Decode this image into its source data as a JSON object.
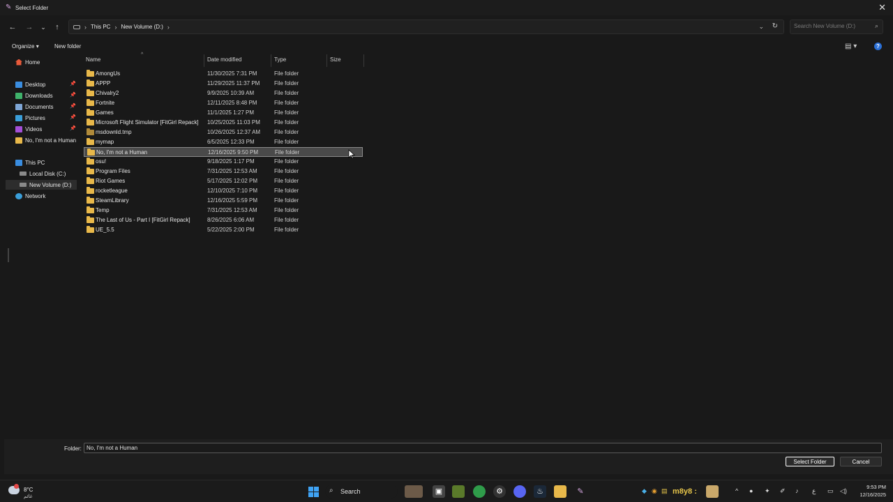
{
  "window": {
    "title": "Select Folder",
    "close_glyph": "✕",
    "icon": "app-icon"
  },
  "nav": {
    "back": "back-icon",
    "forward": "forward-icon",
    "recent": "chevron-down-icon",
    "up": "up-icon",
    "breadcrumbs": [
      "This PC",
      "New Volume (D:)"
    ],
    "search_placeholder": "Search New Volume (D:)"
  },
  "commands": {
    "organize": "Organize",
    "new_folder": "New folder"
  },
  "sidebar": {
    "home": "Home",
    "quick_access": [
      {
        "label": "Desktop",
        "color": "#3a8de0"
      },
      {
        "label": "Downloads",
        "color": "#3fb26b"
      },
      {
        "label": "Documents",
        "color": "#7ea6d6"
      },
      {
        "label": "Pictures",
        "color": "#3a9ed9"
      },
      {
        "label": "Videos",
        "color": "#a44fd8"
      },
      {
        "label": "No, I'm not a Human",
        "color": "#e8b84a"
      }
    ],
    "this_pc": "This PC",
    "drives": [
      "Local Disk (C:)",
      "New Volume (D:)"
    ],
    "network": "Network"
  },
  "columns": {
    "name": "Name",
    "date": "Date modified",
    "type": "Type",
    "size": "Size"
  },
  "files": [
    {
      "name": "AmongUs",
      "date": "11/30/2025 7:31 PM",
      "type": "File folder"
    },
    {
      "name": "APPP",
      "date": "11/29/2025 11:37 PM",
      "type": "File folder"
    },
    {
      "name": "Chivalry2",
      "date": "9/9/2025 10:39 AM",
      "type": "File folder"
    },
    {
      "name": "Fortnite",
      "date": "12/11/2025 8:48 PM",
      "type": "File folder"
    },
    {
      "name": "Games",
      "date": "11/1/2025 1:27 PM",
      "type": "File folder"
    },
    {
      "name": "Microsoft Flight Simulator [FitGirl Repack]",
      "date": "10/25/2025 11:03 PM",
      "type": "File folder"
    },
    {
      "name": "msdownld.tmp",
      "date": "10/26/2025 12:37 AM",
      "type": "File folder"
    },
    {
      "name": "mymap",
      "date": "6/5/2025 12:33 PM",
      "type": "File folder"
    },
    {
      "name": "No, I'm not a Human",
      "date": "12/16/2025 9:50 PM",
      "type": "File folder"
    },
    {
      "name": "osu!",
      "date": "9/18/2025 1:17 PM",
      "type": "File folder"
    },
    {
      "name": "Program Files",
      "date": "7/31/2025 12:53 AM",
      "type": "File folder"
    },
    {
      "name": "Riot Games",
      "date": "5/17/2025 12:02 PM",
      "type": "File folder"
    },
    {
      "name": "rocketleague",
      "date": "12/10/2025 7:10 PM",
      "type": "File folder"
    },
    {
      "name": "SteamLibrary",
      "date": "12/16/2025 5:59 PM",
      "type": "File folder"
    },
    {
      "name": "Temp",
      "date": "7/31/2025 12:53 AM",
      "type": "File folder"
    },
    {
      "name": "The Last of Us - Part I [FitGirl Repack]",
      "date": "8/26/2025 6:06 AM",
      "type": "File folder"
    },
    {
      "name": "UE_5.5",
      "date": "5/22/2025 2:00 PM",
      "type": "File folder"
    }
  ],
  "selected_row": 8,
  "bottom": {
    "folder_label": "Folder:",
    "folder_value": "No, I'm not a Human",
    "select_button": "Select Folder",
    "cancel_button": "Cancel"
  },
  "taskbar": {
    "temp": "8°C",
    "condition": "غائم",
    "search": "Search",
    "tray_text": "m8y8 :",
    "lang": "ع",
    "time": "9:53 PM",
    "date": "12/16/2025"
  }
}
